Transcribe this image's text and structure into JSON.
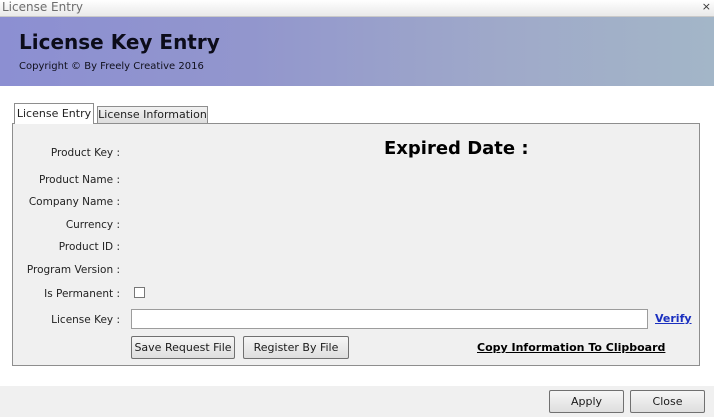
{
  "window": {
    "title": "License Entry",
    "close_glyph": "×"
  },
  "banner": {
    "heading": "License Key Entry",
    "copyright": "Copyright ©  By Freely Creative 2016"
  },
  "tabs": [
    {
      "label": "License Entry",
      "active": true
    },
    {
      "label": "License Information",
      "active": false
    }
  ],
  "form": {
    "labels": {
      "product_key": "Product Key :",
      "product_name": "Product Name :",
      "company_name": "Company Name :",
      "currency": "Currency :",
      "product_id": "Product ID :",
      "program_version": "Program Version :",
      "is_permanent": "Is Permanent :",
      "license_key": "License Key :"
    },
    "expired_date_label": "Expired Date :",
    "is_permanent_checked": false,
    "license_key_value": "",
    "verify_link": "Verify",
    "save_request_button": "Save Request File",
    "register_by_file_button": "Register By File",
    "copy_link": "Copy Information To Clipboard"
  },
  "footer": {
    "apply_button": "Apply",
    "close_button": "Close"
  }
}
